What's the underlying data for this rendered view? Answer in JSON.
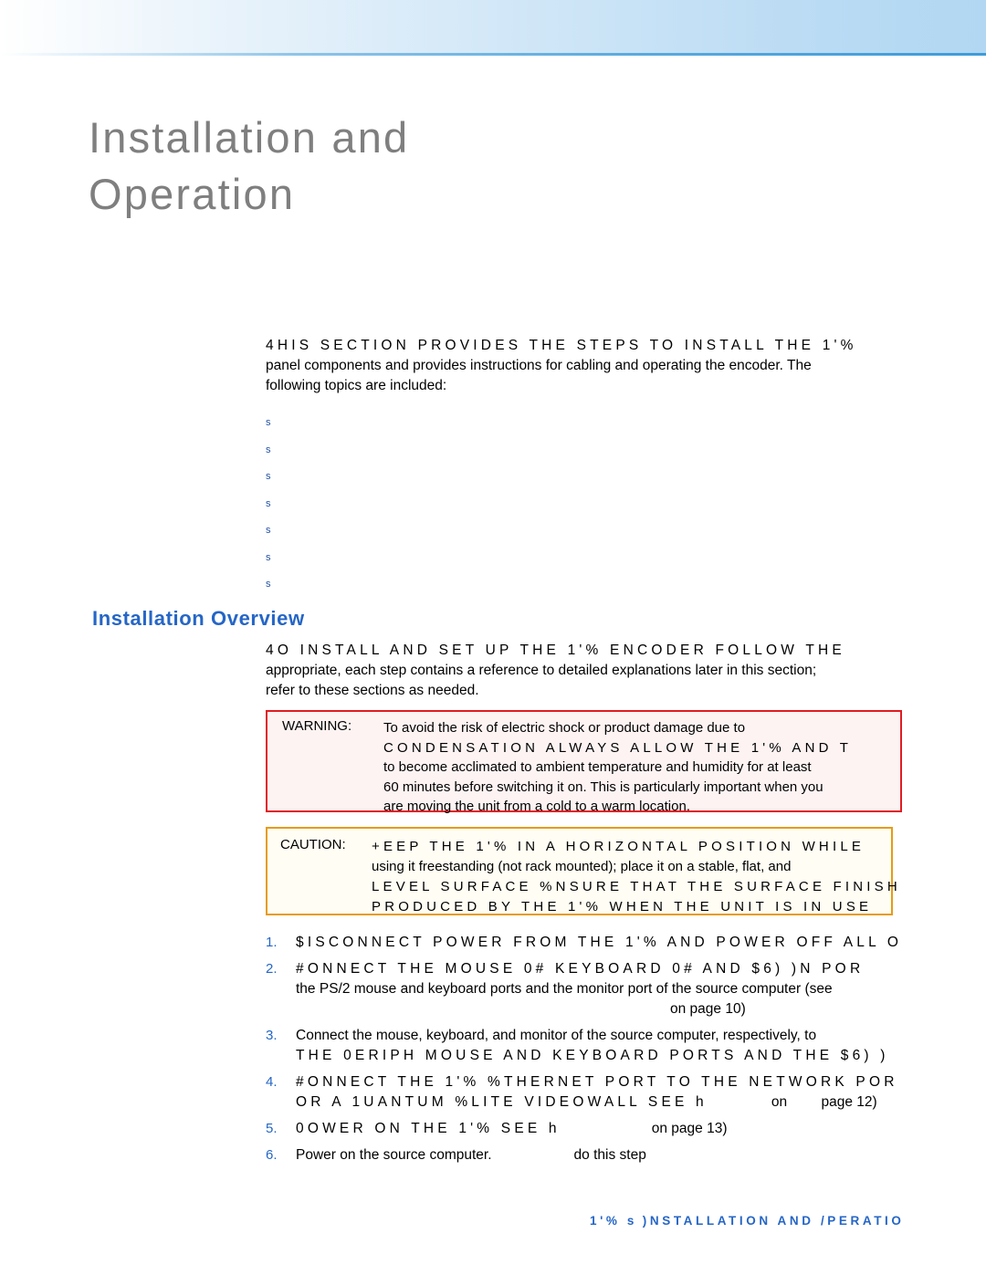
{
  "page": {
    "title_line1": "Installation and",
    "title_line2": "Operation"
  },
  "intro": {
    "caps_lead": "4HIS SECTION PROVIDES THE STEPS TO INSTALL THE 1'% ",
    "rest_line1": "panel components and provides instructions for cabling and operating the encoder. The",
    "rest_line2": "following topics are included:"
  },
  "bullets": [
    {
      "marker": "s",
      "label": ""
    },
    {
      "marker": "s",
      "label": ""
    },
    {
      "marker": "s",
      "label": ""
    },
    {
      "marker": "s",
      "label": ""
    },
    {
      "marker": "s",
      "label": ""
    },
    {
      "marker": "s",
      "label": ""
    },
    {
      "marker": "s",
      "label": ""
    }
  ],
  "section": {
    "heading": "Installation Overview"
  },
  "overview": {
    "caps_lead": "4O INSTALL AND SET UP THE 1'% ENCODER FOLLOW THE ",
    "line2": "appropriate, each step contains a reference to detailed explanations later in this section;",
    "line3": "refer to these sections as needed."
  },
  "warning": {
    "label": "WARNING:",
    "line1": "To avoid the risk of electric shock or product damage due to",
    "line2_caps": "CONDENSATION ALWAYS ALLOW THE 1'% AND T",
    "line3": "to become acclimated to ambient temperature and humidity for at least",
    "line4": "60 minutes before switching it on. This is particularly important when you",
    "line5": "are moving the unit from a cold to a warm location."
  },
  "caution": {
    "label": "CAUTION:",
    "line1_caps": "+EEP THE 1'% IN A HORIZONTAL POSITION WHILE",
    "line2": "using it freestanding (not rack mounted); place it on a stable, flat, and",
    "line3_caps": "LEVEL SURFACE %NSURE THAT THE SURFACE FINISH",
    "line4_caps": "PRODUCED BY THE 1'% WHEN THE UNIT IS IN USE"
  },
  "steps": [
    {
      "num": "1.",
      "caps": "$ISCONNECT POWER FROM THE 1'% AND POWER OFF ALL O"
    },
    {
      "num": "2.",
      "caps": "#ONNECT THE MOUSE 0#  KEYBOARD 0#  AND $6) )N POR",
      "cont1": "the PS/2 mouse and keyboard ports and the monitor port of the source computer (see",
      "cont_ref": "on page 10)"
    },
    {
      "num": "3.",
      "line1": "Connect the mouse, keyboard, and monitor of the source computer, respectively, to",
      "caps2": "THE 0ERIPH MOUSE AND KEYBOARD PORTS AND THE $6) )"
    },
    {
      "num": "4.",
      "caps": "#ONNECT THE 1'% %THERNET PORT TO THE NETWORK POR",
      "caps2": "OR A 1UANTUM %LITE VIDEOWALL SEE h",
      "caps2_tail": "on",
      "cont": "page 12)"
    },
    {
      "num": "5.",
      "caps": "0OWER ON THE 1'% SEE h",
      "tail": "on page 13)"
    },
    {
      "num": "6.",
      "line1": "Power on the source computer.",
      "tail": "do this step"
    }
  ],
  "footer": {
    "product": "1'%",
    "separator": "s",
    "text": ")NSTALLATION AND /PERATIO"
  },
  "colors": {
    "accent_blue": "#2566c6",
    "title_gray": "#7f7f7f",
    "warning_border": "#e11b22",
    "caution_border": "#e79b14",
    "bullet_blue": "#1f4fa0"
  }
}
